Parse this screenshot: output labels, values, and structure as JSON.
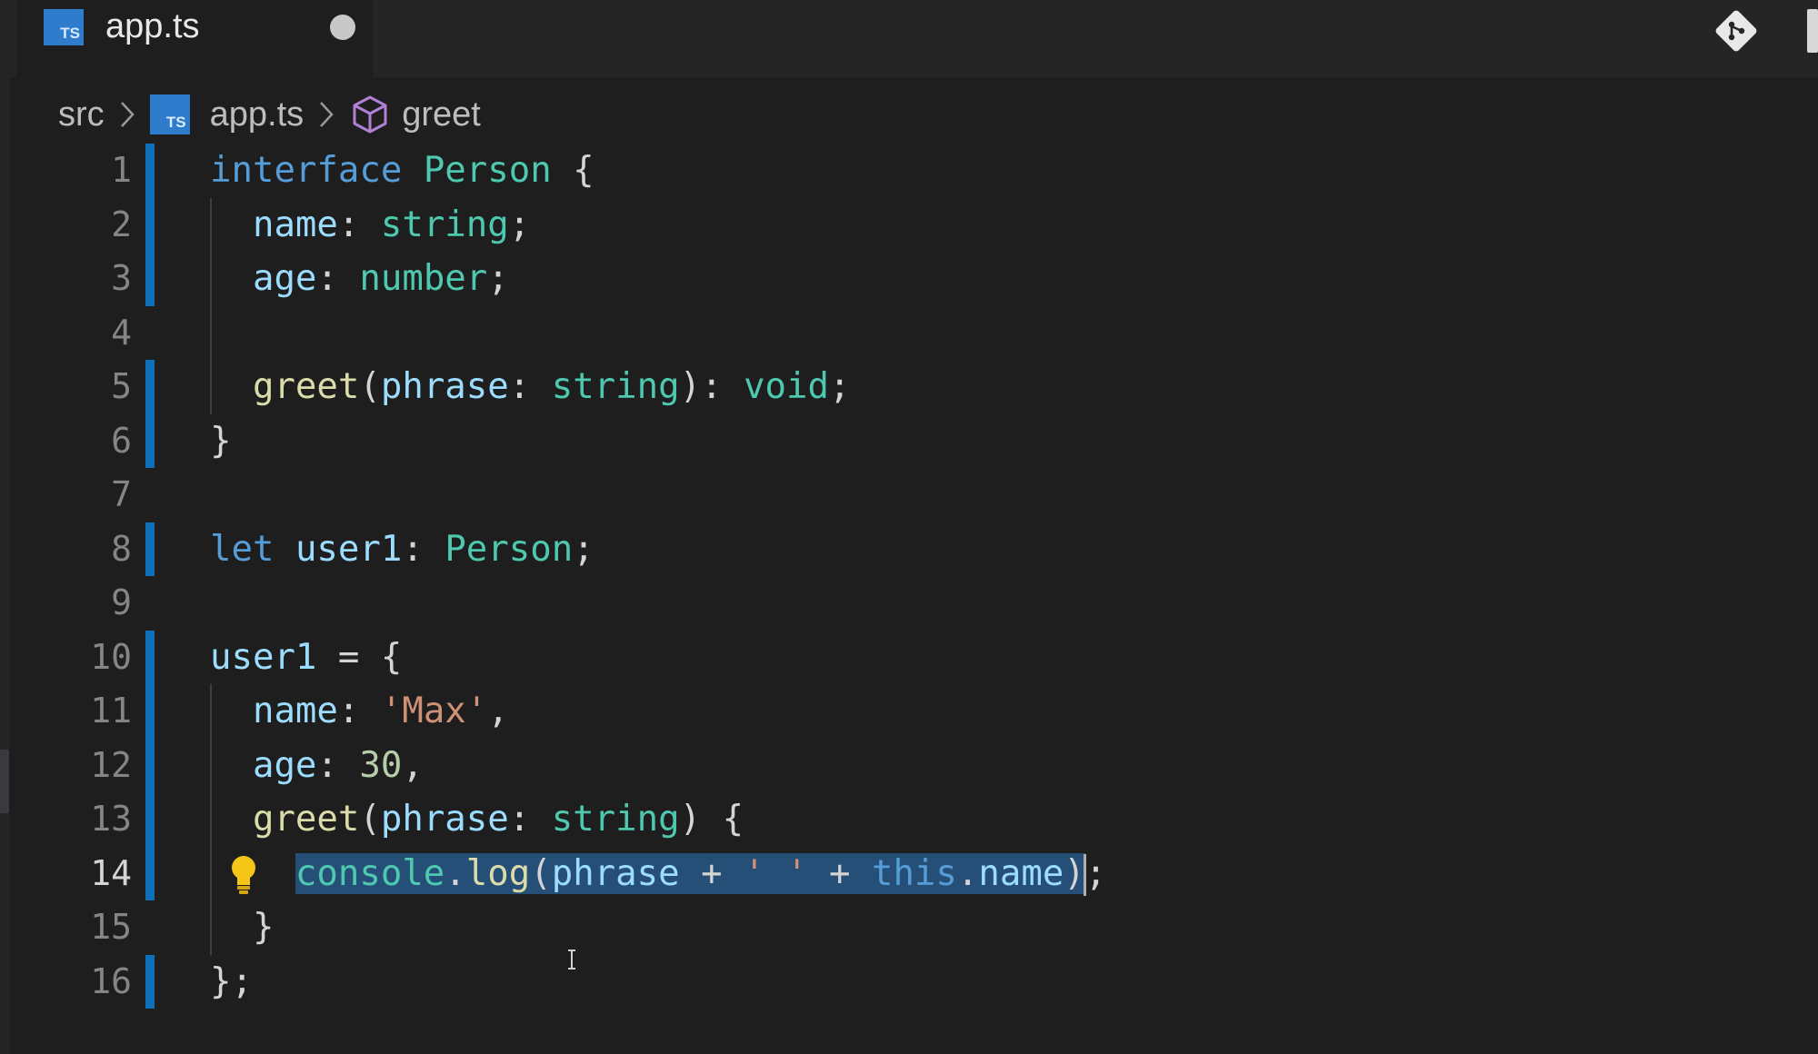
{
  "tab": {
    "badge": "TS",
    "filename": "app.ts",
    "dirty": true
  },
  "breadcrumb": {
    "folder": "src",
    "file_badge": "TS",
    "file": "app.ts",
    "symbol": "greet"
  },
  "editor": {
    "current_line": 14,
    "lines": [
      {
        "n": "1",
        "modified": true,
        "guide": false,
        "tokens": [
          [
            "kw",
            "interface"
          ],
          [
            "pl",
            " "
          ],
          [
            "ty",
            "Person"
          ],
          [
            "pl",
            " {"
          ]
        ]
      },
      {
        "n": "2",
        "modified": true,
        "guide": true,
        "tokens": [
          [
            "pl",
            "  "
          ],
          [
            "pr",
            "name"
          ],
          [
            "pl",
            ": "
          ],
          [
            "ty",
            "string"
          ],
          [
            "pl",
            ";"
          ]
        ]
      },
      {
        "n": "3",
        "modified": true,
        "guide": true,
        "tokens": [
          [
            "pl",
            "  "
          ],
          [
            "pr",
            "age"
          ],
          [
            "pl",
            ": "
          ],
          [
            "ty",
            "number"
          ],
          [
            "pl",
            ";"
          ]
        ]
      },
      {
        "n": "4",
        "modified": false,
        "guide": true,
        "tokens": []
      },
      {
        "n": "5",
        "modified": true,
        "guide": true,
        "tokens": [
          [
            "pl",
            "  "
          ],
          [
            "fn",
            "greet"
          ],
          [
            "pl",
            "("
          ],
          [
            "pr",
            "phrase"
          ],
          [
            "pl",
            ": "
          ],
          [
            "ty",
            "string"
          ],
          [
            "pl",
            "): "
          ],
          [
            "ty",
            "void"
          ],
          [
            "pl",
            ";"
          ]
        ]
      },
      {
        "n": "6",
        "modified": true,
        "guide": false,
        "tokens": [
          [
            "pl",
            "}"
          ]
        ]
      },
      {
        "n": "7",
        "modified": false,
        "guide": false,
        "tokens": []
      },
      {
        "n": "8",
        "modified": true,
        "guide": false,
        "tokens": [
          [
            "kw",
            "let"
          ],
          [
            "pl",
            " "
          ],
          [
            "pr",
            "user1"
          ],
          [
            "pl",
            ": "
          ],
          [
            "ty",
            "Person"
          ],
          [
            "pl",
            ";"
          ]
        ]
      },
      {
        "n": "9",
        "modified": false,
        "guide": false,
        "tokens": []
      },
      {
        "n": "10",
        "modified": true,
        "guide": false,
        "tokens": [
          [
            "pr",
            "user1"
          ],
          [
            "pl",
            " = {"
          ]
        ]
      },
      {
        "n": "11",
        "modified": true,
        "guide": true,
        "tokens": [
          [
            "pl",
            "  "
          ],
          [
            "pr",
            "name"
          ],
          [
            "pl",
            ": "
          ],
          [
            "st",
            "'Max'"
          ],
          [
            "pl",
            ","
          ]
        ]
      },
      {
        "n": "12",
        "modified": true,
        "guide": true,
        "tokens": [
          [
            "pl",
            "  "
          ],
          [
            "pr",
            "age"
          ],
          [
            "pl",
            ": "
          ],
          [
            "nu",
            "30"
          ],
          [
            "pl",
            ","
          ]
        ]
      },
      {
        "n": "13",
        "modified": true,
        "guide": true,
        "tokens": [
          [
            "pl",
            "  "
          ],
          [
            "fn",
            "greet"
          ],
          [
            "pl",
            "("
          ],
          [
            "pr",
            "phrase"
          ],
          [
            "pl",
            ": "
          ],
          [
            "ty",
            "string"
          ],
          [
            "pl",
            ") {"
          ]
        ]
      },
      {
        "n": "14",
        "modified": true,
        "guide": true,
        "lightbulb": true,
        "tokens": [
          [
            "pl",
            "    "
          ],
          [
            "ty",
            "console",
            "sel"
          ],
          [
            "pl",
            ".",
            "sel"
          ],
          [
            "fn",
            "log",
            "sel"
          ],
          [
            "pl",
            "(",
            "sel"
          ],
          [
            "pr",
            "phrase",
            "sel"
          ],
          [
            "pl",
            " + ",
            "sel"
          ],
          [
            "st",
            "' '",
            "sel"
          ],
          [
            "pl",
            " + ",
            "sel"
          ],
          [
            "kw",
            "this",
            "sel"
          ],
          [
            "pl",
            ".",
            "sel"
          ],
          [
            "pr",
            "name",
            "sel"
          ],
          [
            "pl",
            ")",
            "sel"
          ],
          [
            "caret",
            ""
          ],
          [
            "pl",
            ";"
          ]
        ]
      },
      {
        "n": "15",
        "modified": false,
        "guide": true,
        "tokens": [
          [
            "pl",
            "  }"
          ]
        ]
      },
      {
        "n": "16",
        "modified": true,
        "guide": false,
        "tokens": [
          [
            "pl",
            "};"
          ]
        ]
      }
    ]
  }
}
